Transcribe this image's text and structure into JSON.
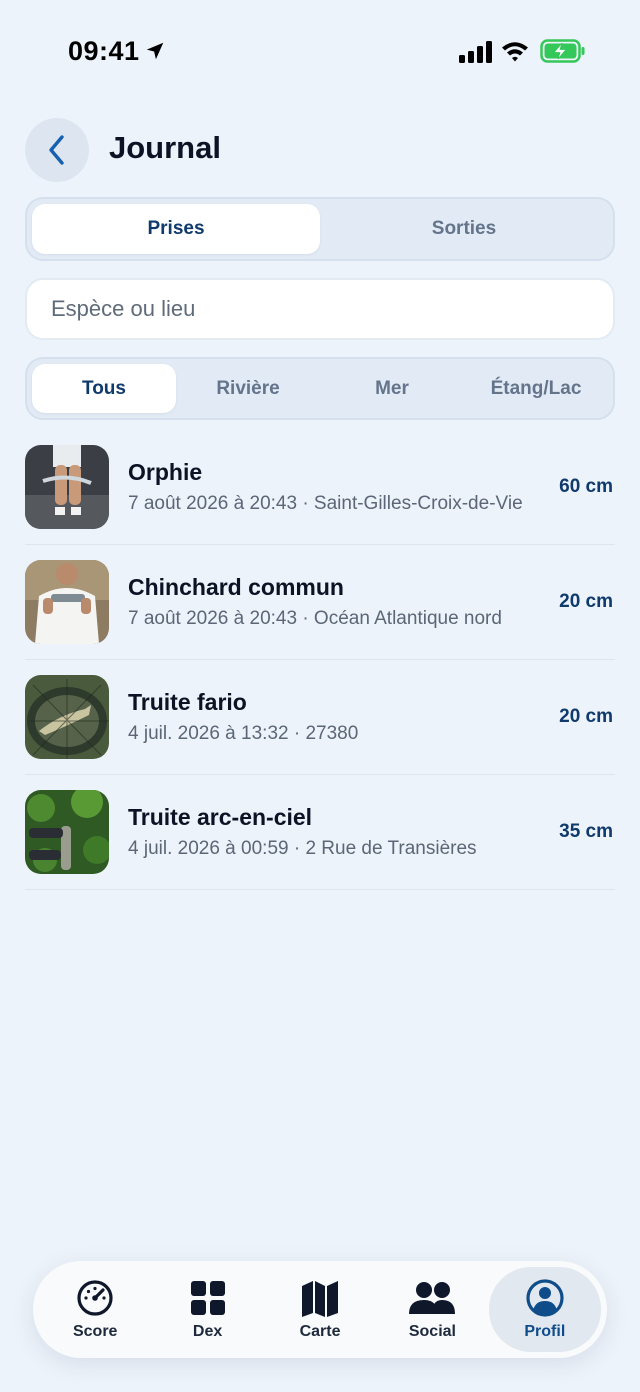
{
  "status_bar": {
    "time": "09:41"
  },
  "header": {
    "title": "Journal"
  },
  "tabs": [
    {
      "label": "Prises",
      "active": true
    },
    {
      "label": "Sorties",
      "active": false
    }
  ],
  "search": {
    "placeholder": "Espèce ou lieu",
    "value": ""
  },
  "filters": [
    {
      "label": "Tous",
      "active": true
    },
    {
      "label": "Rivière",
      "active": false
    },
    {
      "label": "Mer",
      "active": false
    },
    {
      "label": "Étang/Lac",
      "active": false
    }
  ],
  "catches": [
    {
      "species": "Orphie",
      "meta": "7 août 2026 à 20:43 · Saint-Gilles-Croix-de-Vie",
      "size": "60 cm"
    },
    {
      "species": "Chinchard commun",
      "meta": "7 août 2026 à 20:43 · Océan Atlantique nord",
      "size": "20 cm"
    },
    {
      "species": "Truite fario",
      "meta": "4 juil. 2026 à 13:32 · 27380",
      "size": "20 cm"
    },
    {
      "species": "Truite arc-en-ciel",
      "meta": "4 juil. 2026 à 00:59 · 2 Rue de Transières",
      "size": "35 cm"
    }
  ],
  "tab_bar": [
    {
      "label": "Score",
      "icon": "gauge-icon"
    },
    {
      "label": "Dex",
      "icon": "grid-icon"
    },
    {
      "label": "Carte",
      "icon": "map-icon"
    },
    {
      "label": "Social",
      "icon": "people-icon"
    },
    {
      "label": "Profil",
      "icon": "profile-icon",
      "active": true
    }
  ],
  "colors": {
    "accent": "#0f4c8a",
    "background": "#edf3fa",
    "battery": "#34c759"
  }
}
